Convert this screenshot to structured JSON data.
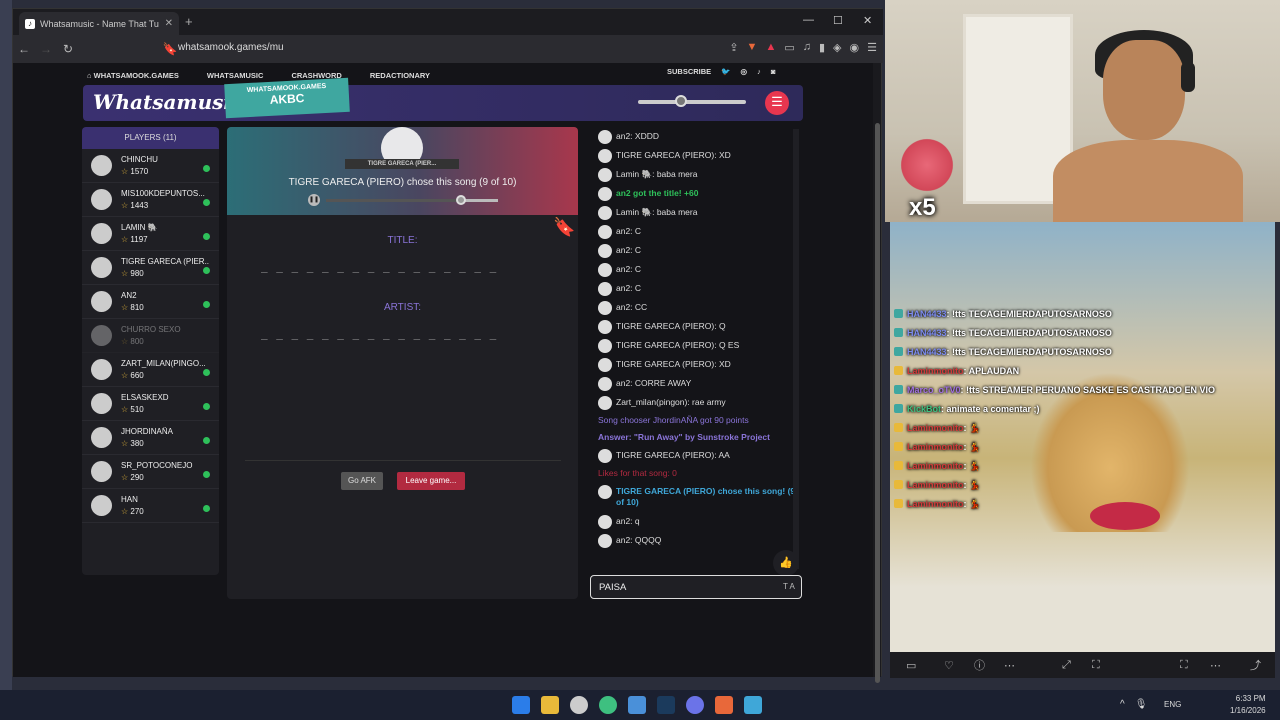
{
  "browser": {
    "tab_title": "Whatsamusic - Name That Tu",
    "url": "whatsamook.games/mu"
  },
  "site_nav": {
    "home": "WHATSAMOOK.GAMES",
    "links": [
      "WHATSAMUSIC",
      "CRASHWORD",
      "REDACTIONARY"
    ],
    "subscribe": "SUBSCRIBE"
  },
  "header": {
    "logo": "Whatsamusic",
    "room_site": "WHATSAMOOK.GAMES",
    "room_code": "AKBC"
  },
  "players": {
    "title": "PLAYERS (11)",
    "list": [
      {
        "name": "CHINCHU",
        "points": "1570",
        "online": true
      },
      {
        "name": "MIS100KDEPUNTOS...",
        "points": "1443",
        "online": true
      },
      {
        "name": "LAMIN 🐘",
        "points": "1197",
        "online": true
      },
      {
        "name": "TIGRE GARECA (PIER...",
        "points": "980",
        "online": true
      },
      {
        "name": "AN2",
        "points": "810",
        "online": true
      },
      {
        "name": "CHURRO SEXO",
        "points": "800",
        "online": false
      },
      {
        "name": "ZART_MILAN(PINGO...",
        "points": "660",
        "online": true
      },
      {
        "name": "ELSASKEXD",
        "points": "510",
        "online": true
      },
      {
        "name": "JHORDINAÑA",
        "points": "380",
        "online": true
      },
      {
        "name": "SR_POTOCONEJO",
        "points": "290",
        "online": true
      },
      {
        "name": "HAN",
        "points": "270",
        "online": true
      }
    ]
  },
  "game": {
    "chooser_ribbon": "TIGRE GARECA (PIER...",
    "chooser_text": "TIGRE GARECA (PIERO) chose this song (9 of 10)",
    "progress": 0.79,
    "title_label": "TITLE:",
    "title_blanks": "_ _   _ _ _ _ _ _ _   _ _ _ _ _ _ _",
    "artist_label": "ARTIST:",
    "artist_blanks": "_ _   _ _ _ _ _ _ _   _ _ _ _ _ _ _",
    "afk_label": "Go AFK",
    "leave_label": "Leave game..."
  },
  "chat": {
    "messages": [
      {
        "type": "msg",
        "text": "an2: XDDD"
      },
      {
        "type": "msg",
        "text": "TIGRE GARECA (PIERO): XD"
      },
      {
        "type": "msg",
        "text": "Lamin 🐘: baba mera"
      },
      {
        "type": "green",
        "text": "an2 got the title! +60"
      },
      {
        "type": "msg",
        "text": "Lamin 🐘: baba mera"
      },
      {
        "type": "msg",
        "text": "an2: C"
      },
      {
        "type": "msg",
        "text": "an2: C"
      },
      {
        "type": "msg",
        "text": "an2: C"
      },
      {
        "type": "msg",
        "text": "an2: C"
      },
      {
        "type": "msg",
        "text": "an2: CC"
      },
      {
        "type": "msg",
        "text": "TIGRE GARECA (PIERO): Q"
      },
      {
        "type": "msg",
        "text": "TIGRE GARECA (PIERO): Q ES"
      },
      {
        "type": "msg",
        "text": "TIGRE GARECA (PIERO): XD"
      },
      {
        "type": "msg",
        "text": "an2: CORRE AWAY"
      },
      {
        "type": "msg",
        "text": "Zart_milan(pingon): rae army"
      },
      {
        "type": "sys",
        "text": "Song chooser JhordinAÑA got 90 points"
      },
      {
        "type": "answer",
        "text": "Answer: \"Run Away\" by Sunstroke Project"
      },
      {
        "type": "msg",
        "text": "TIGRE GARECA (PIERO): AA"
      },
      {
        "type": "pink",
        "text": "Likes for that song: 0"
      },
      {
        "type": "chose",
        "text": "TIGRE GARECA (PIERO) chose this song! (9 of 10)"
      },
      {
        "type": "msg",
        "text": "an2: q"
      },
      {
        "type": "msg",
        "text": "an2: QQQQ"
      }
    ],
    "input_value": "PAISA",
    "input_tools": "T A"
  },
  "stream_overlay": {
    "multiplier": "x5",
    "chat": [
      {
        "user": "HAN4433",
        "color": "u",
        "badge": "",
        "text": ": !tts TECAGEMIERDAPUTOSARNOSO"
      },
      {
        "user": "HAN4433",
        "color": "u",
        "badge": "",
        "text": ": !tts TECAGEMIERDAPUTOSARNOSO"
      },
      {
        "user": "HAN4433",
        "color": "u",
        "badge": "",
        "text": ": !tts TECAGEMIERDAPUTOSARNOSO"
      },
      {
        "user": "Laminmonito",
        "color": "r",
        "badge": "y",
        "text": ": APLAUDAN"
      },
      {
        "user": "Marco_oTV0",
        "color": "p",
        "badge": "",
        "text": ": !tts STREAMER PERUANO SASKE ES CASTRADO EN VIO"
      },
      {
        "user": "KickBot",
        "color": "g",
        "badge": "",
        "text": ": animate a comentar ;)"
      },
      {
        "user": "Laminmonito",
        "color": "r",
        "badge": "y",
        "text": ": 💃"
      },
      {
        "user": "Laminmonito",
        "color": "r",
        "badge": "y",
        "text": ": 💃"
      },
      {
        "user": "Laminmonito",
        "color": "r",
        "badge": "y",
        "text": ": 💃"
      },
      {
        "user": "Laminmonito",
        "color": "r",
        "badge": "y",
        "text": ": 💃"
      },
      {
        "user": "Laminmonito",
        "color": "r",
        "badge": "y",
        "text": ": 💃"
      }
    ]
  },
  "taskbar": {
    "lang": "ENG",
    "time": "6:33 PM",
    "date": "1/16/2026"
  }
}
